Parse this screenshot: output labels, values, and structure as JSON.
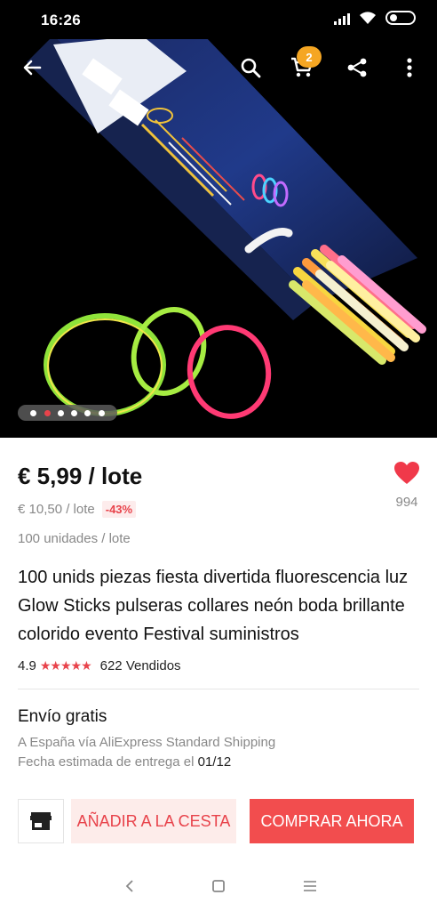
{
  "status_bar": {
    "time": "16:26"
  },
  "toolbar": {
    "cart_count": "2",
    "icons": [
      "back-arrow-icon",
      "search-icon",
      "cart-icon",
      "share-icon",
      "more-vertical-icon"
    ]
  },
  "gallery": {
    "image_count": 6,
    "active_index": 1
  },
  "product": {
    "price": "€ 5,99 / lote",
    "original_price": "€ 10,50 / lote",
    "discount": "-43%",
    "unit_note": "100 unidades / lote",
    "title": "100 unids piezas fiesta divertida fluorescencia luz Glow Sticks pulseras collares neón boda brillante colorido evento Festival suministros",
    "rating": "4.9",
    "stars": "★★★★★",
    "sold": "622 Vendidos",
    "wishlist_count": "994"
  },
  "shipping": {
    "title": "Envío gratis",
    "method": "A España vía AliExpress Standard Shipping",
    "date_prefix": "Fecha estimada de entrega el ",
    "date": "01/12"
  },
  "actions": {
    "add_to_cart": "AÑADIR A LA CESTA",
    "buy_now": "COMPRAR AHORA"
  },
  "colors": {
    "accent": "#f24d4e",
    "accent_light": "#fdecea",
    "badge": "#f5a623"
  }
}
